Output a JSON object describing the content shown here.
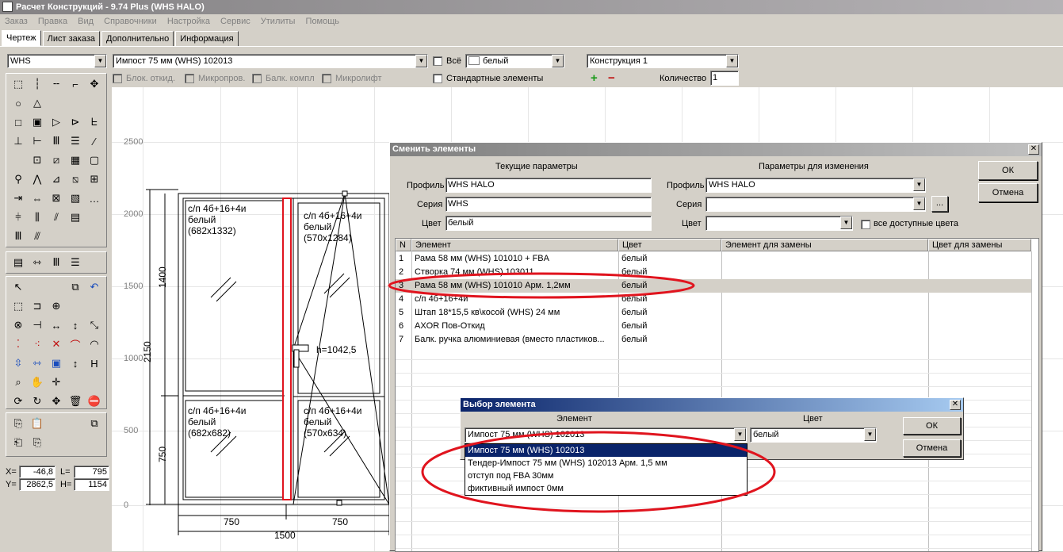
{
  "app": {
    "title": "Расчет Конструкций - 9.74 Plus (WHS HALO)"
  },
  "menu": [
    "Заказ",
    "Правка",
    "Вид",
    "Справочники",
    "Настройка",
    "Сервис",
    "Утилиты",
    "Помощь"
  ],
  "tabs": [
    "Чертеж",
    "Лист заказа",
    "Дополнительно",
    "Информация"
  ],
  "toolbar": {
    "series": "WHS",
    "element": "Импост  75 мм (WHS) 102013",
    "all_label": "Всё",
    "color": "белый",
    "construction": "Конструкция 1",
    "chk_blok": "Блок. откид.",
    "chk_micro": "Микропров.",
    "chk_balk": "Балк. компл",
    "chk_microlift": "Микролифт",
    "chk_standard": "Стандартные элементы",
    "qty_label": "Количество",
    "qty_value": "1",
    "plus": "+",
    "minus": "−"
  },
  "coords": {
    "x_label": "X=",
    "x": "-46,8",
    "l_label": "L=",
    "l": "795",
    "y_label": "Y=",
    "y": "2862,5",
    "h_label": "H=",
    "h": "1154"
  },
  "drawing": {
    "y_ticks": [
      "2500",
      "2000",
      "1500",
      "1000",
      "500",
      "0"
    ],
    "pane_tl": [
      "с/п 4б+16+4и",
      "белый",
      "(682x1332)"
    ],
    "pane_tr": [
      "с/п 4б+16+4и",
      "белый",
      "(570x1284)"
    ],
    "pane_bl": [
      "с/п 4б+16+4и",
      "белый",
      "(682x682)"
    ],
    "pane_br": [
      "с/п 4б+16+4и",
      "белый",
      "(570x634)"
    ],
    "h_label": "h=1042,5",
    "dim_1400": "1400",
    "dim_2150": "2150",
    "dim_750v": "750",
    "dim_750a": "750",
    "dim_750b": "750",
    "dim_1500": "1500"
  },
  "change_dialog": {
    "title": "Сменить элементы",
    "current_header": "Текущие параметры",
    "change_header": "Параметры для изменения",
    "profile_label": "Профиль",
    "series_label": "Серия",
    "color_label": "Цвет",
    "cur_profile": "WHS HALO",
    "cur_series": "WHS",
    "cur_color": "белый",
    "new_profile": "WHS HALO",
    "new_series": "",
    "new_color": "",
    "all_colors": "все доступные цвета",
    "ok": "ОК",
    "cancel": "Отмена",
    "ellipsis": "...",
    "columns": [
      "N",
      "Элемент",
      "Цвет",
      "Элемент для замены",
      "Цвет для замены"
    ],
    "rows": [
      {
        "n": "1",
        "element": "Рама  58 мм (WHS) 101010 + FBA",
        "color": "белый"
      },
      {
        "n": "2",
        "element": "Створка  74 мм (WHS) 103011",
        "color": "белый"
      },
      {
        "n": "3",
        "element": "Рама  58 мм (WHS) 101010 Арм. 1,2мм",
        "color": "белый"
      },
      {
        "n": "4",
        "element": "с/п 4б+16+4и",
        "color": "белый"
      },
      {
        "n": "5",
        "element": "Штап 18*15,5 кв\\косой (WHS) 24 мм",
        "color": "белый"
      },
      {
        "n": "6",
        "element": " AXOR  Пов-Откид",
        "color": "белый"
      },
      {
        "n": "7",
        "element": "Балк. ручка алюминиевая (вместо пластиков...",
        "color": "белый"
      }
    ]
  },
  "select_dialog": {
    "title": "Выбор элемента",
    "element_header": "Элемент",
    "color_header": "Цвет",
    "element_value": "Импост  75 мм (WHS) 102013",
    "color_value": "белый",
    "ok": "ОК",
    "cancel": "Отмена",
    "options": [
      "Импост  75 мм (WHS) 102013",
      "Тендер-Импост  75 мм (WHS) 102013 Арм. 1,5 мм",
      "отступ под FBA 30мм",
      "фиктивный импост 0мм"
    ]
  },
  "colors": {
    "highlight_ellipse": "#e0141e",
    "select_bg": "#0a246a",
    "dialog_title": "#0a246a"
  }
}
